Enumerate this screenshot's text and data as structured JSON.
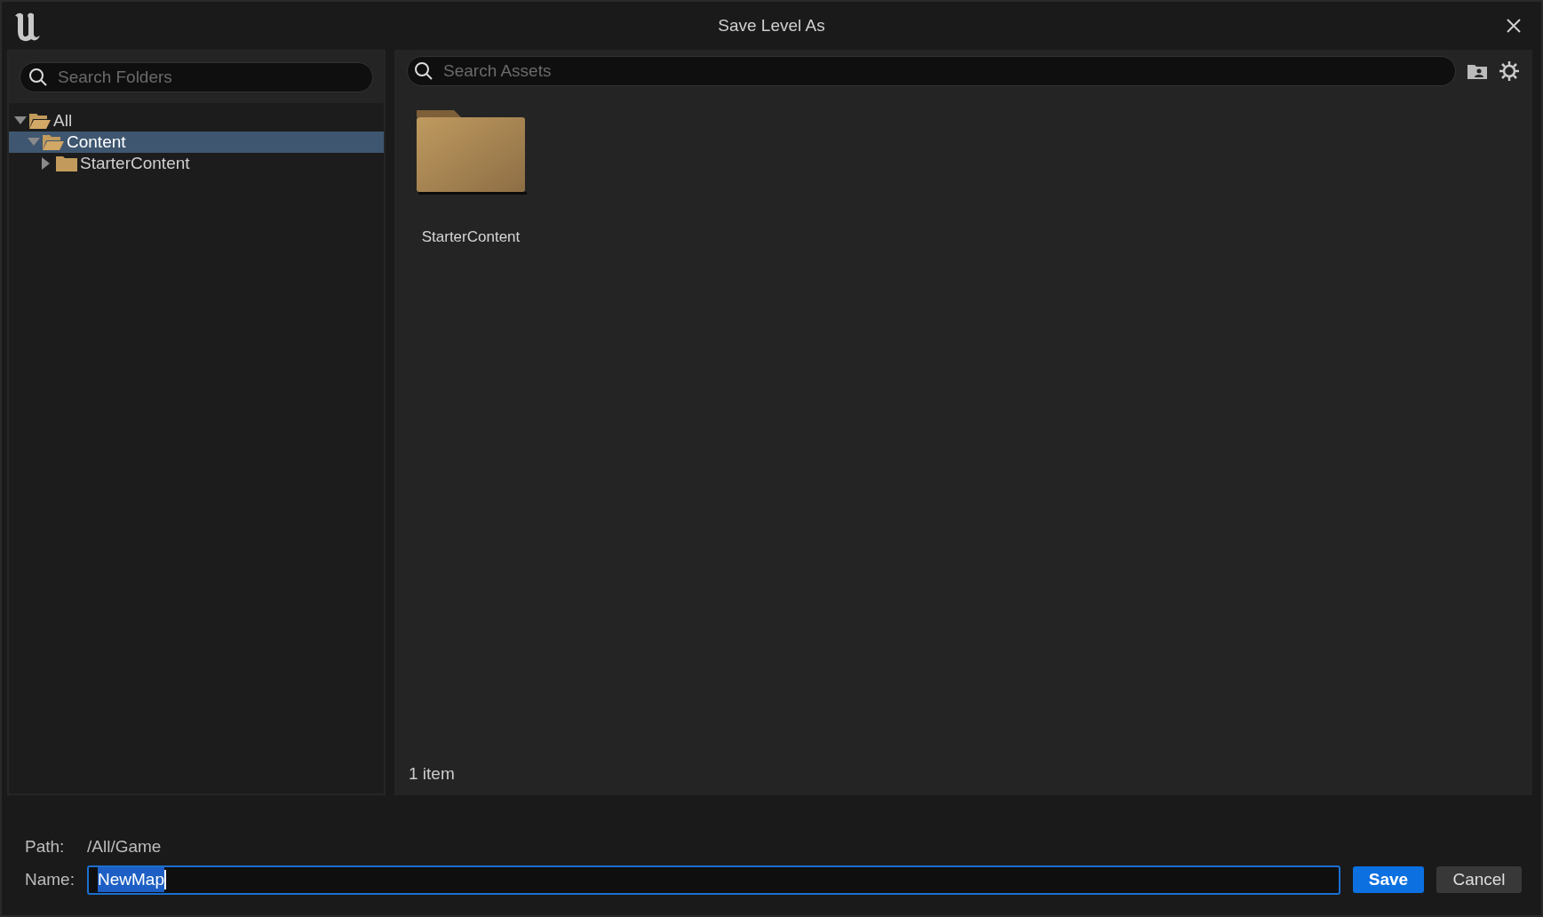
{
  "window": {
    "title": "Save Level As"
  },
  "folder_search": {
    "placeholder": "Search Folders"
  },
  "folder_tree": [
    {
      "label": "All",
      "expanded": true,
      "selected": false,
      "children": [
        {
          "label": "Content",
          "expanded": true,
          "selected": true,
          "children": [
            {
              "label": "StarterContent",
              "expanded": false,
              "selected": false
            }
          ]
        }
      ]
    }
  ],
  "asset_search": {
    "placeholder": "Search Assets"
  },
  "assets": [
    {
      "kind": "folder",
      "label": "StarterContent"
    }
  ],
  "item_count": "1 item",
  "path": {
    "label": "Path:",
    "value": "/All/Game"
  },
  "name": {
    "label": "Name:",
    "value": "NewMap",
    "text_selected": true
  },
  "buttons": [
    {
      "kind": "primary",
      "label": "Save"
    },
    {
      "kind": "secondary",
      "label": "Cancel"
    }
  ]
}
